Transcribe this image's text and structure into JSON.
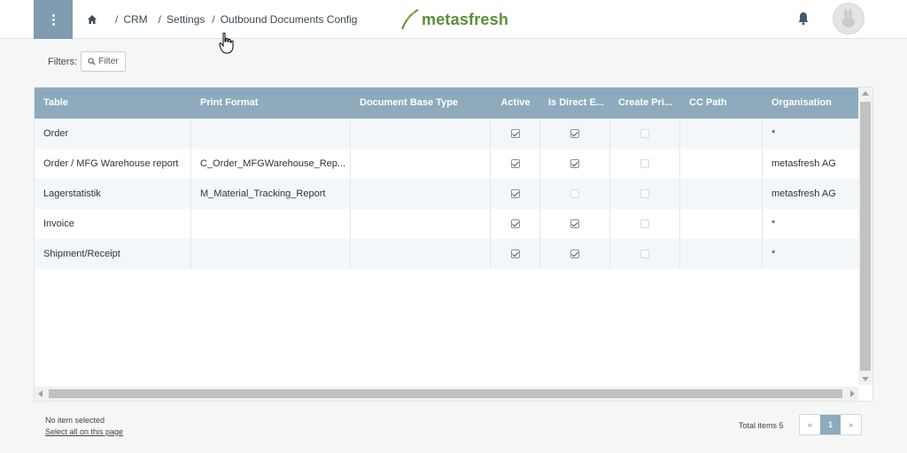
{
  "header": {
    "breadcrumb": [
      "CRM",
      "Settings",
      "Outbound Documents Config"
    ],
    "separator": "/",
    "logo_text": "metasfresh",
    "accent_color": "#7f9cb0",
    "logo_color": "#5a8f3c"
  },
  "filters": {
    "label": "Filters:",
    "button_label": "Filter"
  },
  "table": {
    "columns": [
      "Table",
      "Print Format",
      "Document Base Type",
      "Active",
      "Is Direct E...",
      "Create Pri...",
      "CC Path",
      "Organisation"
    ],
    "rows": [
      {
        "table": "Order",
        "print_format": "",
        "doc_base_type": "",
        "active": true,
        "is_direct": true,
        "create_print": false,
        "cc_path": "",
        "organisation": "*"
      },
      {
        "table": "Order / MFG Warehouse report",
        "print_format": "C_Order_MFGWarehouse_Rep...",
        "doc_base_type": "",
        "active": true,
        "is_direct": true,
        "create_print": false,
        "cc_path": "",
        "organisation": "metasfresh AG"
      },
      {
        "table": "Lagerstatistik",
        "print_format": "M_Material_Tracking_Report",
        "doc_base_type": "",
        "active": true,
        "is_direct": false,
        "create_print": false,
        "cc_path": "",
        "organisation": "metasfresh AG"
      },
      {
        "table": "Invoice",
        "print_format": "",
        "doc_base_type": "",
        "active": true,
        "is_direct": true,
        "create_print": false,
        "cc_path": "",
        "organisation": "*"
      },
      {
        "table": "Shipment/Receipt",
        "print_format": "",
        "doc_base_type": "",
        "active": true,
        "is_direct": true,
        "create_print": false,
        "cc_path": "",
        "organisation": "*"
      }
    ]
  },
  "footer": {
    "no_item": "No item selected",
    "select_all": "Select all on this page",
    "total": "Total items 5",
    "pager": {
      "prev": "«",
      "current": "1",
      "next": "»"
    }
  }
}
